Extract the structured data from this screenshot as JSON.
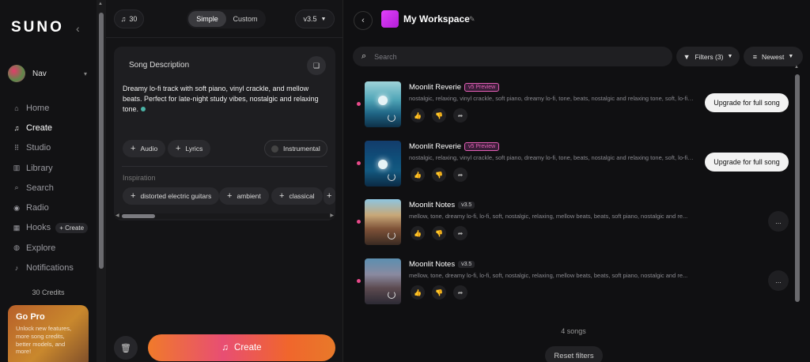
{
  "sidebar": {
    "logo": "SUNO",
    "collapse_icon": "chevron-left",
    "user": {
      "name": "Nav"
    },
    "nav": [
      {
        "label": "Home",
        "icon": "home"
      },
      {
        "label": "Create",
        "icon": "music-note",
        "active": true
      },
      {
        "label": "Studio",
        "icon": "studio"
      },
      {
        "label": "Library",
        "icon": "library"
      },
      {
        "label": "Search",
        "icon": "search"
      },
      {
        "label": "Radio",
        "icon": "radio"
      },
      {
        "label": "Hooks",
        "icon": "hooks",
        "badge": "+ Create"
      },
      {
        "label": "Explore",
        "icon": "explore"
      },
      {
        "label": "Notifications",
        "icon": "bell"
      }
    ],
    "credits": "30 Credits",
    "gopro": {
      "title": "Go Pro",
      "text": "Unlock new features, more song credits, better models, and more!"
    }
  },
  "composer": {
    "credits_pill": "30",
    "mode_simple": "Simple",
    "mode_custom": "Custom",
    "model": "v3.5",
    "section_title": "Song Description",
    "description": "Dreamy lo-fi track with soft piano, vinyl crackle, and mellow beats. Perfect for late-night study vibes, nostalgic and relaxing tone.",
    "audio_label": "Audio",
    "lyrics_label": "Lyrics",
    "instrumental_label": "Instrumental",
    "inspiration_label": "Inspiration",
    "inspiration_chips": [
      "distorted electric guitars",
      "ambient",
      "classical"
    ],
    "create_label": "Create"
  },
  "workspace": {
    "title": "My Workspace",
    "search_placeholder": "Search",
    "filters_label": "Filters (3)",
    "sort_label": "Newest",
    "songs": [
      {
        "title": "Moonlit Reverie",
        "badge": "v5 Preview",
        "badge_type": "v5",
        "tags": "nostalgic, relaxing, vinyl crackle, soft piano, dreamy lo-fi, tone, beats, nostalgic and relaxing tone, soft, lo-fi, soft piano, ...",
        "cta": "Upgrade for full song",
        "cover": "sea"
      },
      {
        "title": "Moonlit Reverie",
        "badge": "v5 Preview",
        "badge_type": "v5",
        "tags": "nostalgic, relaxing, vinyl crackle, soft piano, dreamy lo-fi, tone, beats, nostalgic and relaxing tone, soft, lo-fi, soft piano, ...",
        "cta": "Upgrade for full song",
        "cover": "sea2"
      },
      {
        "title": "Moonlit Notes",
        "badge": "v3.5",
        "badge_type": "v35",
        "tags": "mellow, tone, dreamy lo-fi, lo-fi, soft, nostalgic, relaxing, mellow beats, beats, soft piano, nostalgic and re...",
        "cta": "...",
        "cover": "room"
      },
      {
        "title": "Moonlit Notes",
        "badge": "v3.5",
        "badge_type": "v35",
        "tags": "mellow, tone, dreamy lo-fi, lo-fi, soft, nostalgic, relaxing, mellow beats, beats, soft piano, nostalgic and re...",
        "cta": "...",
        "cover": "room2"
      }
    ],
    "count": "4 songs",
    "reset_label": "Reset filters"
  },
  "colors": {
    "accent_pink": "#e84a8a",
    "create_gradient_start": "#f07a2a",
    "create_gradient_mid": "#e84e73"
  }
}
